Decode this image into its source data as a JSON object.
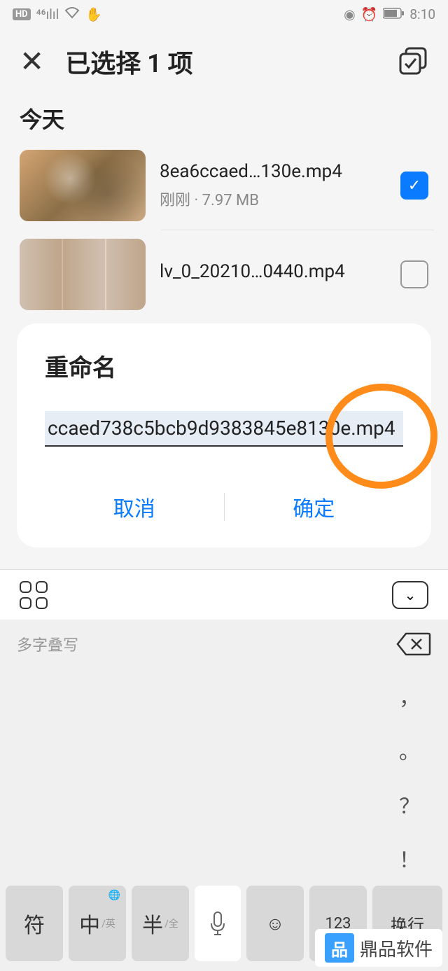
{
  "status": {
    "time": "8:10"
  },
  "header": {
    "title": "已选择 1 项"
  },
  "section": {
    "today": "今天"
  },
  "files": [
    {
      "name": "8ea6ccaed…130e.mp4",
      "meta": "刚刚 · 7.97 MB",
      "checked": true
    },
    {
      "name": "lv_0_20210…0440.mp4",
      "meta": "",
      "checked": false
    }
  ],
  "dialog": {
    "title": "重命名",
    "input_value": "ccaed738c5bcb9d9383845e8130e.mp4",
    "cancel": "取消",
    "confirm": "确定"
  },
  "keyboard": {
    "hint": "多字叠写",
    "suggestions": [
      "，",
      "。",
      "？",
      "！"
    ],
    "keys": {
      "sym": "符",
      "zh": "中",
      "zh_sub": "/英",
      "half": "半",
      "half_sub": "/全",
      "num": "123",
      "enter": "换行"
    }
  },
  "watermark": {
    "text": "鼎品软件"
  }
}
